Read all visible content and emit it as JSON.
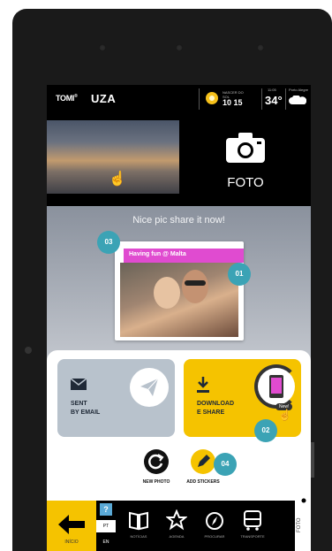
{
  "topbar": {
    "brand_tomi": "TOMI",
    "brand_uza": "UZA",
    "sunrise_label_1": "NASCER DO",
    "sunrise_label_2": "SOL",
    "sunrise_time": "10 15",
    "clock_small": "11:05",
    "temperature": "34°",
    "city": "Porto Alegre"
  },
  "header": {
    "foto_label": "FOTO"
  },
  "share": {
    "headline": "Nice pic share it now!",
    "sticker_text": "Having fun @ Malta"
  },
  "badges": {
    "b01": "01",
    "b02": "02",
    "b03": "03",
    "b04": "04"
  },
  "actions": {
    "email_line1": "SENT",
    "email_line2": "BY EMAIL",
    "download_line1": "DOWNLOAD",
    "download_line2": "E SHARE",
    "new_pill": "New!",
    "new_photo": "NEW PHOTO",
    "add_stickers": "ADD STICKERS"
  },
  "nav": {
    "home": "INÍCIO",
    "help": "?",
    "lang_pt": "PT",
    "lang_en": "EN",
    "items": [
      {
        "label": "NOTÍCIAS",
        "icon": "book-icon"
      },
      {
        "label": "AGENDA",
        "icon": "star-icon"
      },
      {
        "label": "PROCURAR",
        "icon": "compass-icon"
      },
      {
        "label": "TRANSPORTE",
        "icon": "bus-icon"
      }
    ],
    "foto_tab": "FOTO"
  },
  "colors": {
    "accent_yellow": "#f5c300",
    "badge_teal": "#3ba3b5",
    "sticker_pink": "#e04bd0"
  }
}
